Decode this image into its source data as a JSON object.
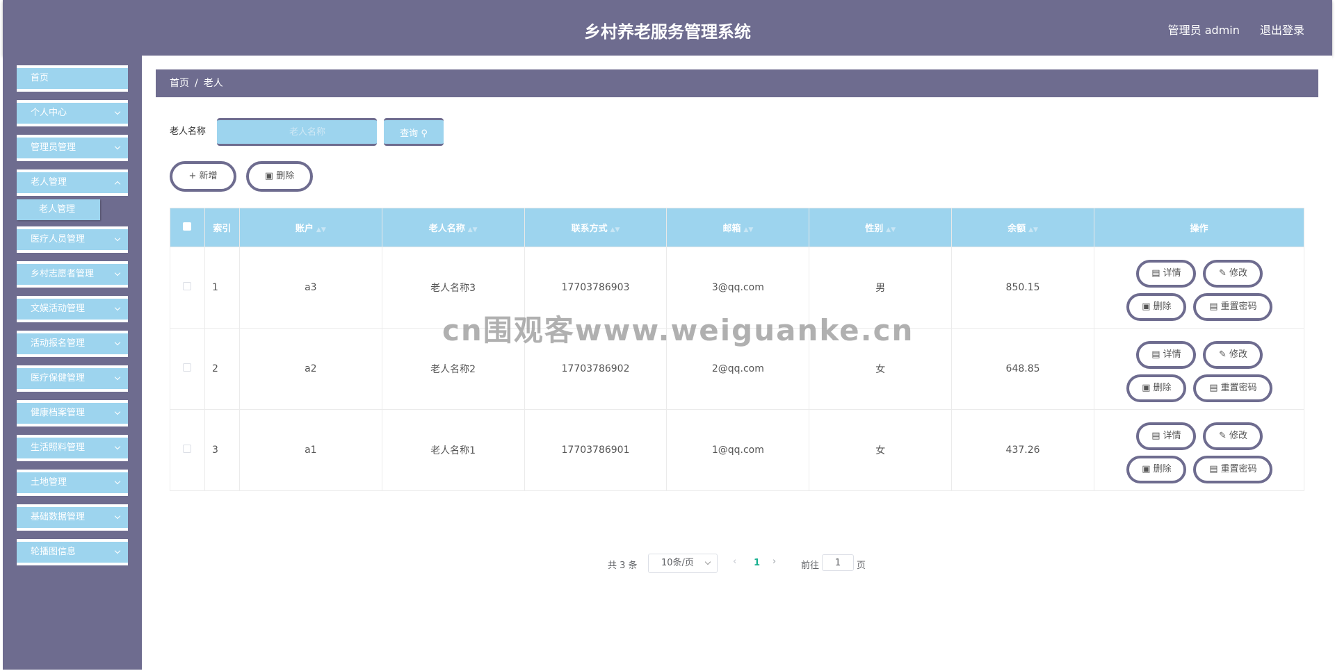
{
  "header": {
    "title": "乡村养老服务管理系统",
    "user": "管理员 admin",
    "logout": "退出登录"
  },
  "sidebar": {
    "items": [
      {
        "label": "首页"
      },
      {
        "label": "个人中心"
      },
      {
        "label": "管理员管理"
      },
      {
        "label": "老人管理"
      },
      {
        "label": "医疗人员管理"
      },
      {
        "label": "乡村志愿者管理"
      },
      {
        "label": "文娱活动管理"
      },
      {
        "label": "活动报名管理"
      },
      {
        "label": "医疗保健管理"
      },
      {
        "label": "健康档案管理"
      },
      {
        "label": "生活照料管理"
      },
      {
        "label": "土地管理"
      },
      {
        "label": "基础数据管理"
      },
      {
        "label": "轮播图信息"
      }
    ],
    "sub_item": "老人管理"
  },
  "breadcrumb": {
    "home": "首页",
    "sep": "/",
    "current": "老人"
  },
  "search": {
    "label": "老人名称",
    "placeholder": "老人名称",
    "button": "查询"
  },
  "actions": {
    "add": "新增",
    "delete": "删除"
  },
  "table": {
    "headers": {
      "index": "索引",
      "account": "账户",
      "name": "老人名称",
      "phone": "联系方式",
      "email": "邮箱",
      "gender": "性别",
      "balance": "余额",
      "ops": "操作"
    },
    "rows": [
      {
        "index": "1",
        "account": "a3",
        "name": "老人名称3",
        "phone": "17703786903",
        "email": "3@qq.com",
        "gender": "男",
        "balance": "850.15"
      },
      {
        "index": "2",
        "account": "a2",
        "name": "老人名称2",
        "phone": "17703786902",
        "email": "2@qq.com",
        "gender": "女",
        "balance": "648.85"
      },
      {
        "index": "3",
        "account": "a1",
        "name": "老人名称1",
        "phone": "17703786901",
        "email": "1@qq.com",
        "gender": "女",
        "balance": "437.26"
      }
    ],
    "op_labels": {
      "detail": "详情",
      "edit": "修改",
      "delete": "删除",
      "reset": "重置密码"
    }
  },
  "pagination": {
    "total": "共 3 条",
    "page_size": "10条/页",
    "current": "1",
    "goto": "前往",
    "goto_value": "1",
    "unit": "页"
  },
  "watermark": "cn围观客www.weiguanke.cn",
  "colors": {
    "primary": "#6e6c8f",
    "accent": "#9dd4ee",
    "pager_active": "#18b08f"
  }
}
